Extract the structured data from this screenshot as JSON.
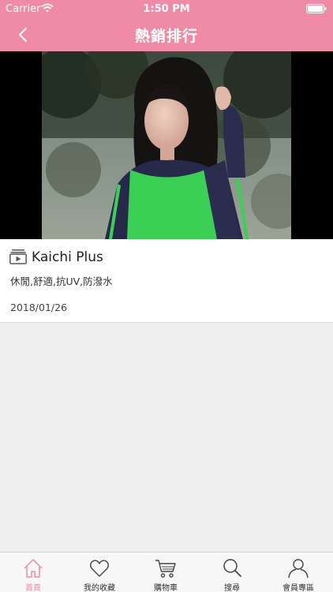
{
  "status_bar": {
    "carrier": "Carrier",
    "time": "1:50 PM"
  },
  "nav": {
    "title": "熱銷排行",
    "accent_color": "#ef8ba7"
  },
  "product": {
    "title": "Kaichi Plus",
    "tags": "休閒,舒適,抗UV,防潑水",
    "date": "2018/01/26",
    "icon": "video-icon"
  },
  "tabs": [
    {
      "label": "首頁",
      "icon": "home-icon",
      "active": true
    },
    {
      "label": "我的收藏",
      "icon": "heart-icon",
      "active": false
    },
    {
      "label": "購物車",
      "icon": "cart-icon",
      "active": false
    },
    {
      "label": "搜尋",
      "icon": "search-icon",
      "active": false
    },
    {
      "label": "會員專區",
      "icon": "user-icon",
      "active": false
    }
  ]
}
